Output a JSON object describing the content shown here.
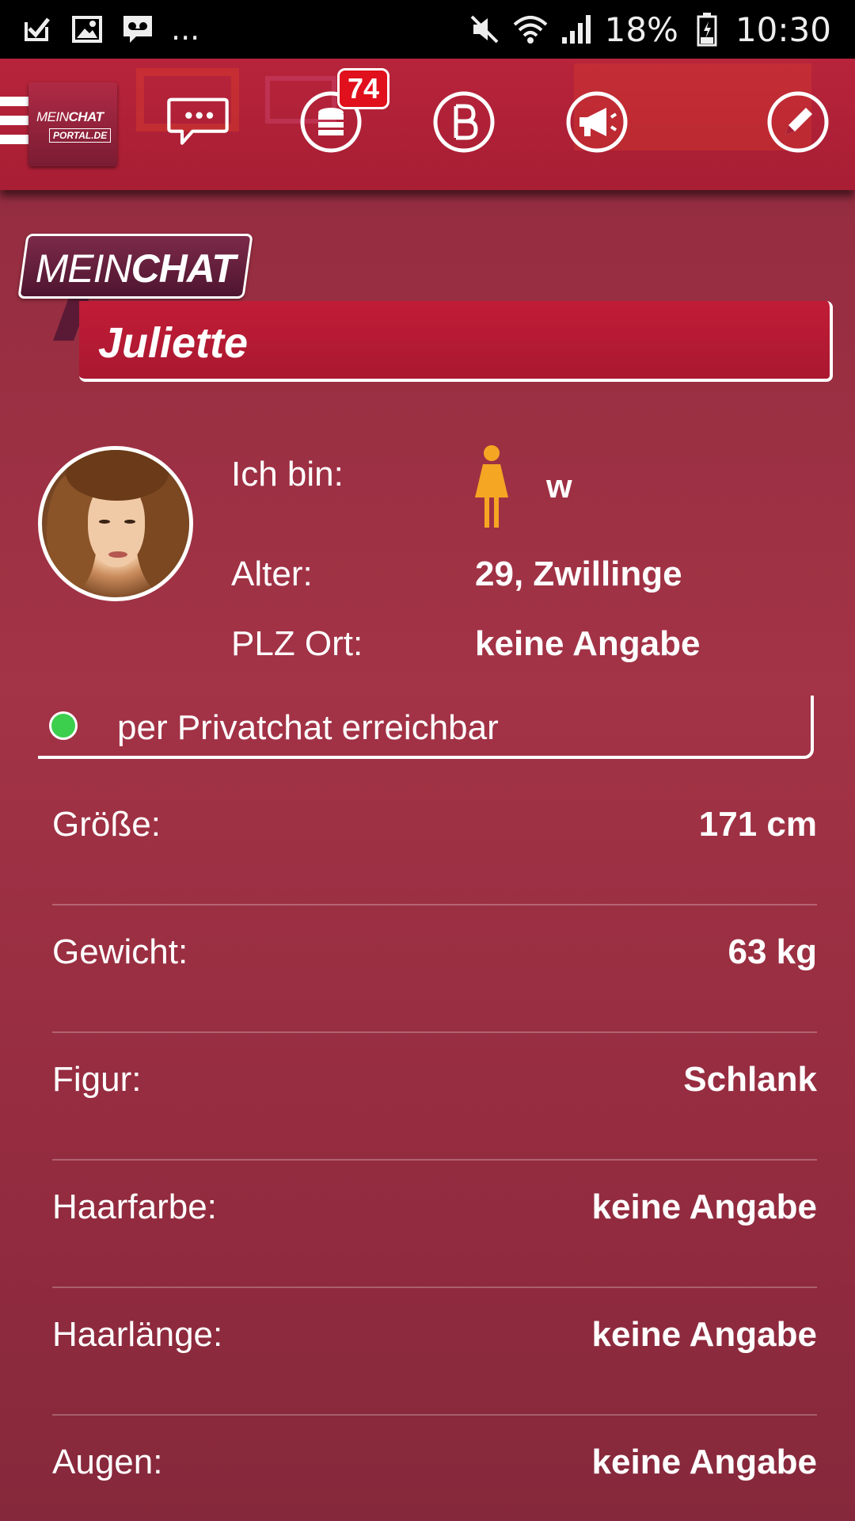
{
  "status_bar": {
    "notification_more": "...",
    "battery": "18%",
    "time": "10:30",
    "icons": [
      "check-icon",
      "image-icon",
      "voicemail-icon",
      "mute-icon",
      "wifi-icon",
      "signal-icon",
      "battery-icon"
    ]
  },
  "app_bar": {
    "logo": {
      "line1_light": "MEIN",
      "line1_bold": "CHAT",
      "line2": "PORTAL.DE"
    },
    "coins_badge": "74",
    "icons": [
      "menu-icon",
      "chat-bubble-icon",
      "coins-icon",
      "b-icon",
      "megaphone-icon",
      "edit-icon"
    ]
  },
  "header": {
    "brand_light": "MEIN",
    "brand_bold": "CHAT",
    "username": "Juliette"
  },
  "profile": {
    "gender_label": "Ich bin:",
    "gender_value": "w",
    "age_label": "Alter:",
    "age_value": "29, Zwillinge",
    "location_label": "PLZ Ort:",
    "location_value": "keine Angabe"
  },
  "availability": {
    "text": "per Privatchat erreichbar",
    "status_color": "#3ccf4e"
  },
  "details": [
    {
      "label": "Größe:",
      "value": "171 cm"
    },
    {
      "label": "Gewicht:",
      "value": "63 kg"
    },
    {
      "label": "Figur:",
      "value": "Schlank"
    },
    {
      "label": "Haarfarbe:",
      "value": "keine Angabe"
    },
    {
      "label": "Haarlänge:",
      "value": "keine Angabe"
    },
    {
      "label": "Augen:",
      "value": "keine Angabe"
    }
  ],
  "colors": {
    "app_bar": "#b7243b",
    "background": "#a33346",
    "badge": "#e0101c",
    "gender_icon": "#f5a623"
  }
}
